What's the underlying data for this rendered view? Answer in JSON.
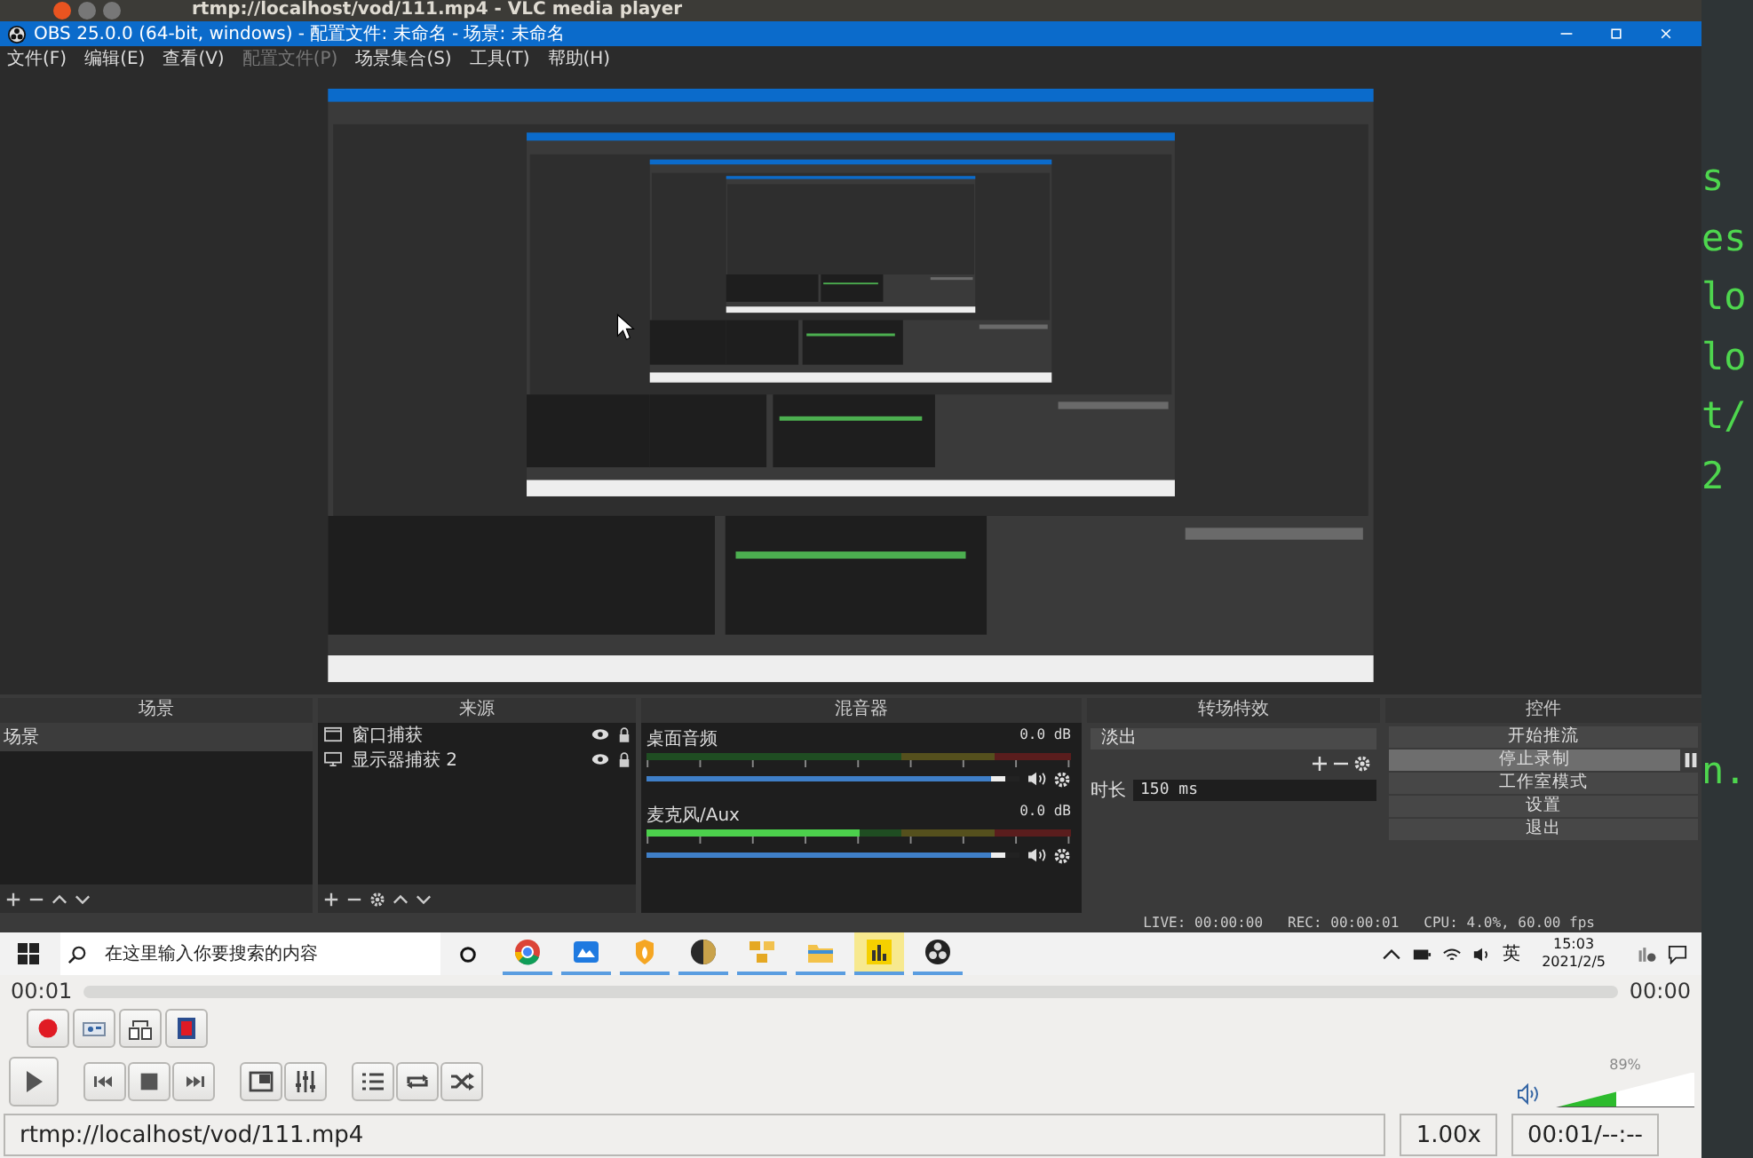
{
  "player": {
    "title": "rtmp://localhost/vod/111.mp4 - VLC media player"
  },
  "obs": {
    "title": "OBS 25.0.0 (64-bit, windows) - 配置文件: 未命名 - 场景: 未命名",
    "menu": [
      {
        "label": "文件(F)",
        "disabled": false
      },
      {
        "label": "编辑(E)",
        "disabled": false
      },
      {
        "label": "查看(V)",
        "disabled": false
      },
      {
        "label": "配置文件(P)",
        "disabled": true
      },
      {
        "label": "场景集合(S)",
        "disabled": false
      },
      {
        "label": "工具(T)",
        "disabled": false
      },
      {
        "label": "帮助(H)",
        "disabled": false
      }
    ],
    "scenes": {
      "title": "场景",
      "items": [
        {
          "label": "场景",
          "selected": true
        }
      ]
    },
    "sources": {
      "title": "来源",
      "items": [
        {
          "kind": "window",
          "label": "窗口捕获"
        },
        {
          "kind": "monitor",
          "label": "显示器捕获 2"
        }
      ]
    },
    "mixer": {
      "title": "混音器",
      "channels": [
        {
          "name": "桌面音频",
          "reading": "0.0 dB",
          "volume": {
            "level": 0.96
          }
        },
        {
          "name": "麦克风/Aux",
          "reading": "0.0 dB",
          "meter": {
            "level": 0.5
          },
          "volume": {
            "level": 0.96
          }
        }
      ]
    },
    "transitions": {
      "title": "转场特效",
      "selected": "淡出",
      "duration_label": "时长",
      "duration": "150 ms"
    },
    "controls": {
      "title": "控件",
      "buttons": [
        {
          "label": "开始推流",
          "active": false
        },
        {
          "label": "停止录制",
          "active": true
        },
        {
          "label": "工作室模式",
          "active": false
        },
        {
          "label": "设置",
          "active": false
        },
        {
          "label": "退出",
          "active": false
        }
      ]
    },
    "status": [
      "LIVE: 00:00:00",
      "REC: 00:00:01",
      "CPU: 4.0%, 60.00 fps"
    ]
  },
  "taskbar": {
    "search": {
      "placeholder": "在这里输入你要搜索的内容"
    },
    "apps": [
      {
        "kind": "browser",
        "selected": false
      },
      {
        "kind": "blue",
        "selected": false
      },
      {
        "kind": "flame",
        "selected": false
      },
      {
        "kind": "game",
        "selected": false
      },
      {
        "kind": "grid",
        "selected": false
      },
      {
        "kind": "folder",
        "selected": false
      },
      {
        "kind": "chart",
        "selected": true
      },
      {
        "kind": "obs",
        "selected": false
      }
    ],
    "ime": "英",
    "time": "15:03",
    "date": "2021/2/5"
  },
  "terminal": {
    "lines": [
      "s",
      "es",
      "lo",
      "lo",
      "t/",
      "2"
    ],
    "lower_lines": [
      "n."
    ]
  },
  "vlc": {
    "elapsed": "00:01",
    "remaining": "00:00",
    "volume": {
      "reading": "89%",
      "level": 0.44
    },
    "status": {
      "media": "rtmp://localhost/vod/111.mp4",
      "speed": "1.00x",
      "time": "00:01/--:--"
    }
  }
}
